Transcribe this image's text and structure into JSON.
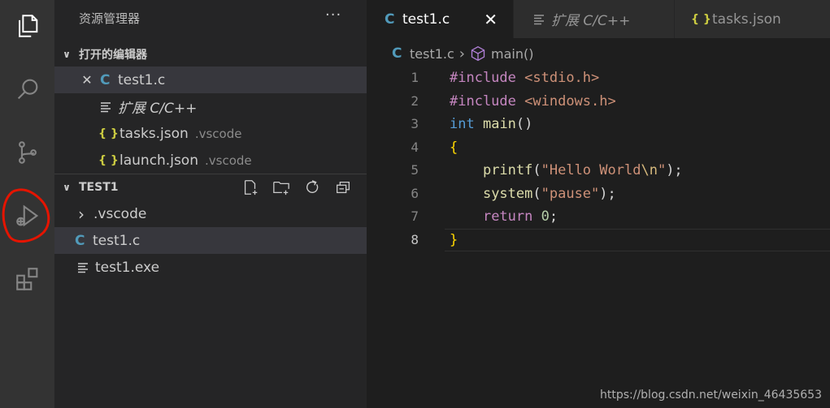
{
  "explorer": {
    "title": "资源管理器",
    "more": "···",
    "open_editors": {
      "header": "打开的编辑器",
      "items": [
        {
          "label": "test1.c",
          "desc": "",
          "icon": "c-file-icon",
          "close": "✕"
        },
        {
          "label": "扩展 C/C++",
          "desc": "",
          "icon": "lines-icon"
        },
        {
          "label": "tasks.json",
          "desc": ".vscode",
          "icon": "json-icon"
        },
        {
          "label": "launch.json",
          "desc": ".vscode",
          "icon": "json-icon"
        }
      ]
    },
    "folder": {
      "header": "TEST1",
      "items": [
        {
          "label": ".vscode",
          "icon": "chevron-right-icon"
        },
        {
          "label": "test1.c",
          "icon": "c-file-icon"
        },
        {
          "label": "test1.exe",
          "icon": "lines-icon"
        }
      ]
    },
    "icon_glyphs": {
      "c": "C",
      "json": "{ }",
      "chev_down": "∨",
      "chev_right": "›"
    }
  },
  "tabs": [
    {
      "label": "test1.c",
      "active": true,
      "close": "✕"
    },
    {
      "label": "扩展 C/C++",
      "active": false
    },
    {
      "label": "tasks.json",
      "active": false
    }
  ],
  "breadcrumb": {
    "file": "test1.c",
    "separator": "›",
    "symbol": "main()"
  },
  "editor": {
    "current_line": 8,
    "line_numbers": [
      "1",
      "2",
      "3",
      "4",
      "5",
      "6",
      "7",
      "8"
    ],
    "lines": [
      "#include <stdio.h>",
      "#include <windows.h>",
      "int main()",
      "{",
      "    printf(\"Hello World\\n\");",
      "    system(\"pause\");",
      "    return 0;",
      "}"
    ]
  },
  "watermark": "https://blog.csdn.net/weixin_46435653",
  "colors": {
    "accent": "#519aba",
    "json": "#cbcb41",
    "annotation": "#e51400"
  }
}
